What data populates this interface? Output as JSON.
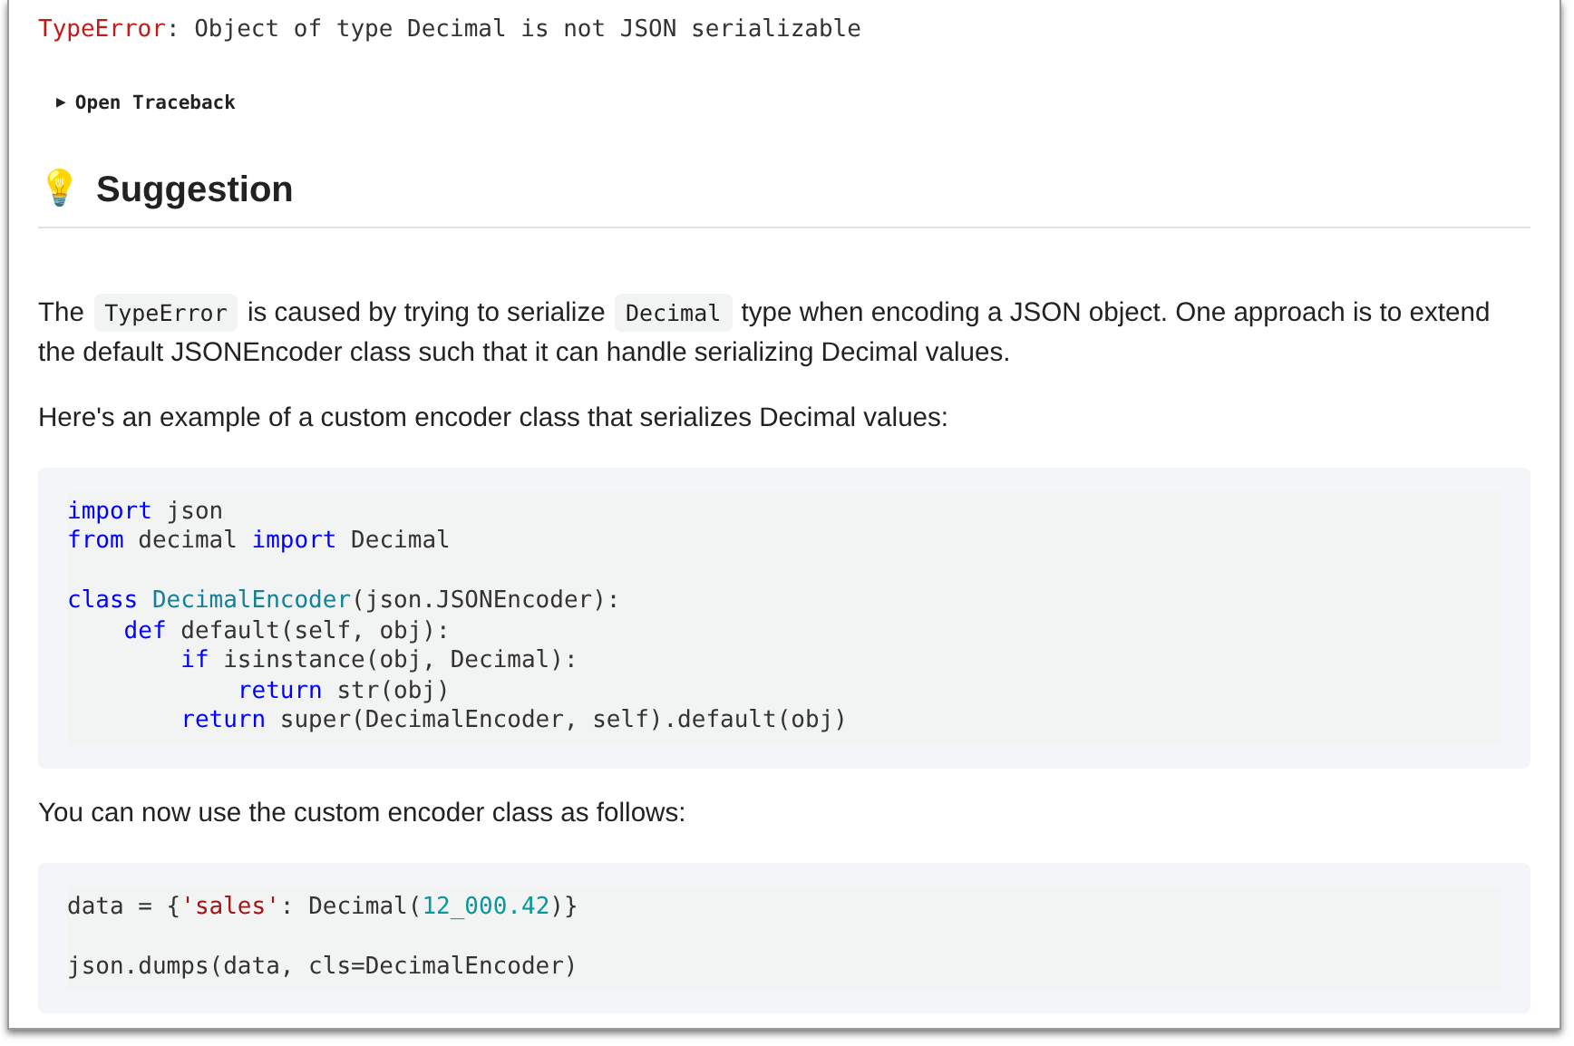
{
  "error": [
    {
      "text": "TypeError",
      "kind": "name"
    },
    {
      "text": ": Object of type Decimal is not JSON serializable",
      "kind": "plain"
    }
  ],
  "traceback": {
    "toggle": "▶",
    "label": "Open Traceback",
    "expanded": false
  },
  "suggestion": {
    "icon": "💡",
    "title": "Suggestion"
  },
  "blocks": [
    {
      "kind": "para",
      "parts": [
        {
          "text": "The ",
          "kind": "text"
        },
        {
          "text": "TypeError",
          "kind": "code"
        },
        {
          "text": " is caused by trying to serialize ",
          "kind": "text"
        },
        {
          "text": "Decimal",
          "kind": "code"
        },
        {
          "text": " type when encoding a JSON object. One approach is to extend the default JSONEncoder class such that it can handle serializing Decimal values.",
          "kind": "text"
        }
      ]
    },
    {
      "kind": "para",
      "parts": [
        {
          "text": "Here's an example of a custom encoder class that serializes Decimal values:",
          "kind": "text"
        }
      ]
    },
    {
      "kind": "code",
      "lines": [
        {
          "gap_before": false,
          "tokens": [
            {
              "text": "import",
              "kind": "keyword"
            },
            {
              "text": " json",
              "kind": "plain"
            }
          ]
        },
        {
          "gap_before": false,
          "tokens": [
            {
              "text": "from",
              "kind": "keyword"
            },
            {
              "text": " decimal ",
              "kind": "plain"
            },
            {
              "text": "import",
              "kind": "keyword"
            },
            {
              "text": " Decimal",
              "kind": "plain"
            }
          ]
        },
        {
          "gap_before": true,
          "tokens": [
            {
              "text": "class ",
              "kind": "keyword"
            },
            {
              "text": "DecimalEncoder",
              "kind": "class"
            },
            {
              "text": "(json.JSONEncoder):",
              "kind": "plain"
            }
          ]
        },
        {
          "gap_before": false,
          "tokens": [
            {
              "text": "    def",
              "kind": "keyword"
            },
            {
              "text": " default(self, obj):",
              "kind": "plain"
            }
          ]
        },
        {
          "gap_before": false,
          "tokens": [
            {
              "text": "        if",
              "kind": "keyword"
            },
            {
              "text": " isinstance(obj, Decimal):",
              "kind": "plain"
            }
          ]
        },
        {
          "gap_before": false,
          "tokens": [
            {
              "text": "            return",
              "kind": "keyword"
            },
            {
              "text": " str(obj)",
              "kind": "plain"
            }
          ]
        },
        {
          "gap_before": false,
          "tokens": [
            {
              "text": "        return",
              "kind": "keyword"
            },
            {
              "text": " super(DecimalEncoder, self).default(obj)",
              "kind": "plain"
            }
          ]
        }
      ]
    },
    {
      "kind": "para",
      "parts": [
        {
          "text": "You can now use the custom encoder class as follows:",
          "kind": "text"
        }
      ]
    },
    {
      "kind": "code",
      "lines": [
        {
          "gap_before": false,
          "tokens": [
            {
              "text": "data = {",
              "kind": "plain"
            },
            {
              "text": "'sales'",
              "kind": "string"
            },
            {
              "text": ": Decimal(",
              "kind": "plain"
            },
            {
              "text": "12_000.42",
              "kind": "number"
            },
            {
              "text": ")}",
              "kind": "plain"
            }
          ]
        },
        {
          "gap_before": true,
          "tokens": [
            {
              "text": "json.dumps(data, cls=DecimalEncoder)",
              "kind": "plain"
            }
          ]
        }
      ]
    }
  ]
}
